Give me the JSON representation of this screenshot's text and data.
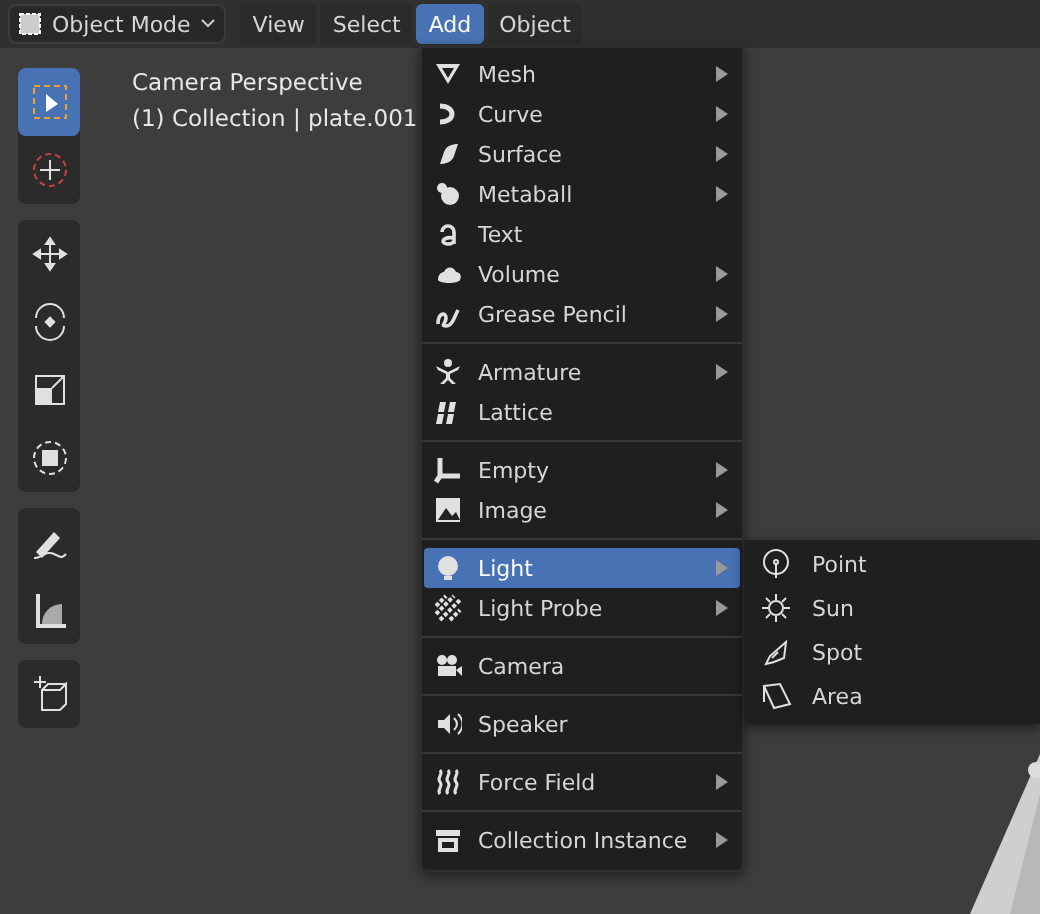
{
  "header": {
    "mode": "Object Mode",
    "menus": [
      {
        "label": "View",
        "selected": false
      },
      {
        "label": "Select",
        "selected": false
      },
      {
        "label": "Add",
        "selected": true
      },
      {
        "label": "Object",
        "selected": false
      }
    ]
  },
  "viewport": {
    "title": "Camera Perspective",
    "subtitle": "(1) Collection | plate.001"
  },
  "toolbar": {
    "groups": [
      [
        {
          "selected": true
        },
        {
          "selected": false
        }
      ],
      [
        {
          "selected": false
        },
        {
          "selected": false
        },
        {
          "selected": false
        },
        {
          "selected": false
        }
      ],
      [
        {
          "selected": false
        },
        {
          "selected": false
        }
      ],
      [
        {
          "selected": false
        }
      ]
    ]
  },
  "add_menu": {
    "sections": [
      [
        {
          "label": "Mesh",
          "submenu": true,
          "selected": false
        },
        {
          "label": "Curve",
          "submenu": true,
          "selected": false
        },
        {
          "label": "Surface",
          "submenu": true,
          "selected": false
        },
        {
          "label": "Metaball",
          "submenu": true,
          "selected": false
        },
        {
          "label": "Text",
          "submenu": false,
          "selected": false
        },
        {
          "label": "Volume",
          "submenu": true,
          "selected": false
        },
        {
          "label": "Grease Pencil",
          "submenu": true,
          "selected": false
        }
      ],
      [
        {
          "label": "Armature",
          "submenu": true,
          "selected": false
        },
        {
          "label": "Lattice",
          "submenu": false,
          "selected": false
        }
      ],
      [
        {
          "label": "Empty",
          "submenu": true,
          "selected": false
        },
        {
          "label": "Image",
          "submenu": true,
          "selected": false
        }
      ],
      [
        {
          "label": "Light",
          "submenu": true,
          "selected": true
        },
        {
          "label": "Light Probe",
          "submenu": true,
          "selected": false
        }
      ],
      [
        {
          "label": "Camera",
          "submenu": false,
          "selected": false
        }
      ],
      [
        {
          "label": "Speaker",
          "submenu": false,
          "selected": false
        }
      ],
      [
        {
          "label": "Force Field",
          "submenu": true,
          "selected": false
        }
      ],
      [
        {
          "label": "Collection Instance",
          "submenu": true,
          "selected": false
        }
      ]
    ]
  },
  "light_submenu": {
    "items": [
      {
        "label": "Point"
      },
      {
        "label": "Sun"
      },
      {
        "label": "Spot"
      },
      {
        "label": "Area"
      }
    ]
  }
}
